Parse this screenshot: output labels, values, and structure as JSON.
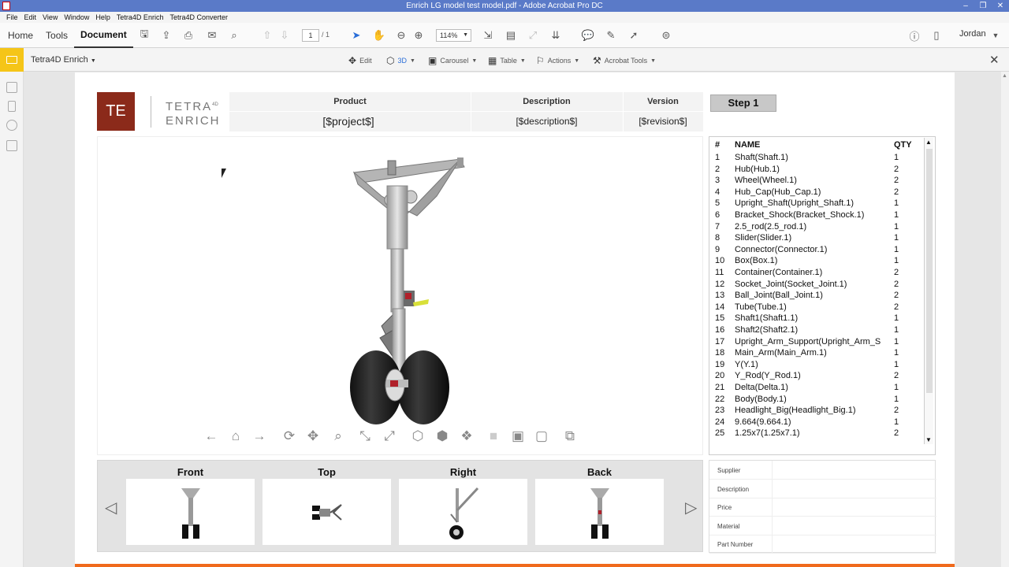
{
  "window": {
    "title": "Enrich LG model test model.pdf - Adobe Acrobat Pro DC"
  },
  "menu": [
    "File",
    "Edit",
    "View",
    "Window",
    "Help",
    "Tetra4D Enrich",
    "Tetra4D Converter"
  ],
  "toolbar": {
    "tabs": [
      "Home",
      "Tools",
      "Document"
    ],
    "active_tab": "Document",
    "page_current": "1",
    "page_total": "/ 1",
    "zoom": "114%",
    "user": "Jordan"
  },
  "subbar": {
    "name": "Tetra4D Enrich",
    "tools": [
      "Edit",
      "3D",
      "Carousel",
      "Table",
      "Actions",
      "Acrobat Tools"
    ]
  },
  "logo": {
    "mark": "TE",
    "line1": "TETRA",
    "sup": "4D",
    "line2": "ENRICH"
  },
  "info": {
    "headers": [
      "Product",
      "Description",
      "Version"
    ],
    "values": [
      "[$project$]",
      "[$description$]",
      "[$revision$]"
    ]
  },
  "step": "Step 1",
  "bom": {
    "headers": [
      "#",
      "NAME",
      "QTY"
    ],
    "rows": [
      [
        "1",
        "Shaft(Shaft.1)",
        "1"
      ],
      [
        "2",
        "Hub(Hub.1)",
        "2"
      ],
      [
        "3",
        "Wheel(Wheel.1)",
        "2"
      ],
      [
        "4",
        "Hub_Cap(Hub_Cap.1)",
        "2"
      ],
      [
        "5",
        "Upright_Shaft(Upright_Shaft.1)",
        "1"
      ],
      [
        "6",
        "Bracket_Shock(Bracket_Shock.1)",
        "1"
      ],
      [
        "7",
        "2.5_rod(2.5_rod.1)",
        "1"
      ],
      [
        "8",
        "Slider(Slider.1)",
        "1"
      ],
      [
        "9",
        "Connector(Connector.1)",
        "1"
      ],
      [
        "10",
        "Box(Box.1)",
        "1"
      ],
      [
        "11",
        "Container(Container.1)",
        "2"
      ],
      [
        "12",
        "Socket_Joint(Socket_Joint.1)",
        "2"
      ],
      [
        "13",
        "Ball_Joint(Ball_Joint.1)",
        "2"
      ],
      [
        "14",
        "Tube(Tube.1)",
        "2"
      ],
      [
        "15",
        "Shaft1(Shaft1.1)",
        "1"
      ],
      [
        "16",
        "Shaft2(Shaft2.1)",
        "1"
      ],
      [
        "17",
        "Upright_Arm_Support(Upright_Arm_S",
        "1"
      ],
      [
        "18",
        "Main_Arm(Main_Arm.1)",
        "1"
      ],
      [
        "19",
        "Y(Y.1)",
        "1"
      ],
      [
        "20",
        "Y_Rod(Y_Rod.1)",
        "2"
      ],
      [
        "21",
        "Delta(Delta.1)",
        "1"
      ],
      [
        "22",
        "Body(Body.1)",
        "1"
      ],
      [
        "23",
        "Headlight_Big(Headlight_Big.1)",
        "2"
      ],
      [
        "24",
        "9.664(9.664.1)",
        "1"
      ],
      [
        "25",
        "1.25x7(1.25x7.1)",
        "2"
      ]
    ]
  },
  "views": [
    "Front",
    "Top",
    "Right",
    "Back"
  ],
  "props": [
    "Supplier",
    "Description",
    "Price",
    "Material",
    "Part Number"
  ],
  "colors": {
    "accent": "#f06a1c",
    "titlebar": "#5a7ac8",
    "logo": "#8b2a1a",
    "folder": "#f5c518"
  }
}
